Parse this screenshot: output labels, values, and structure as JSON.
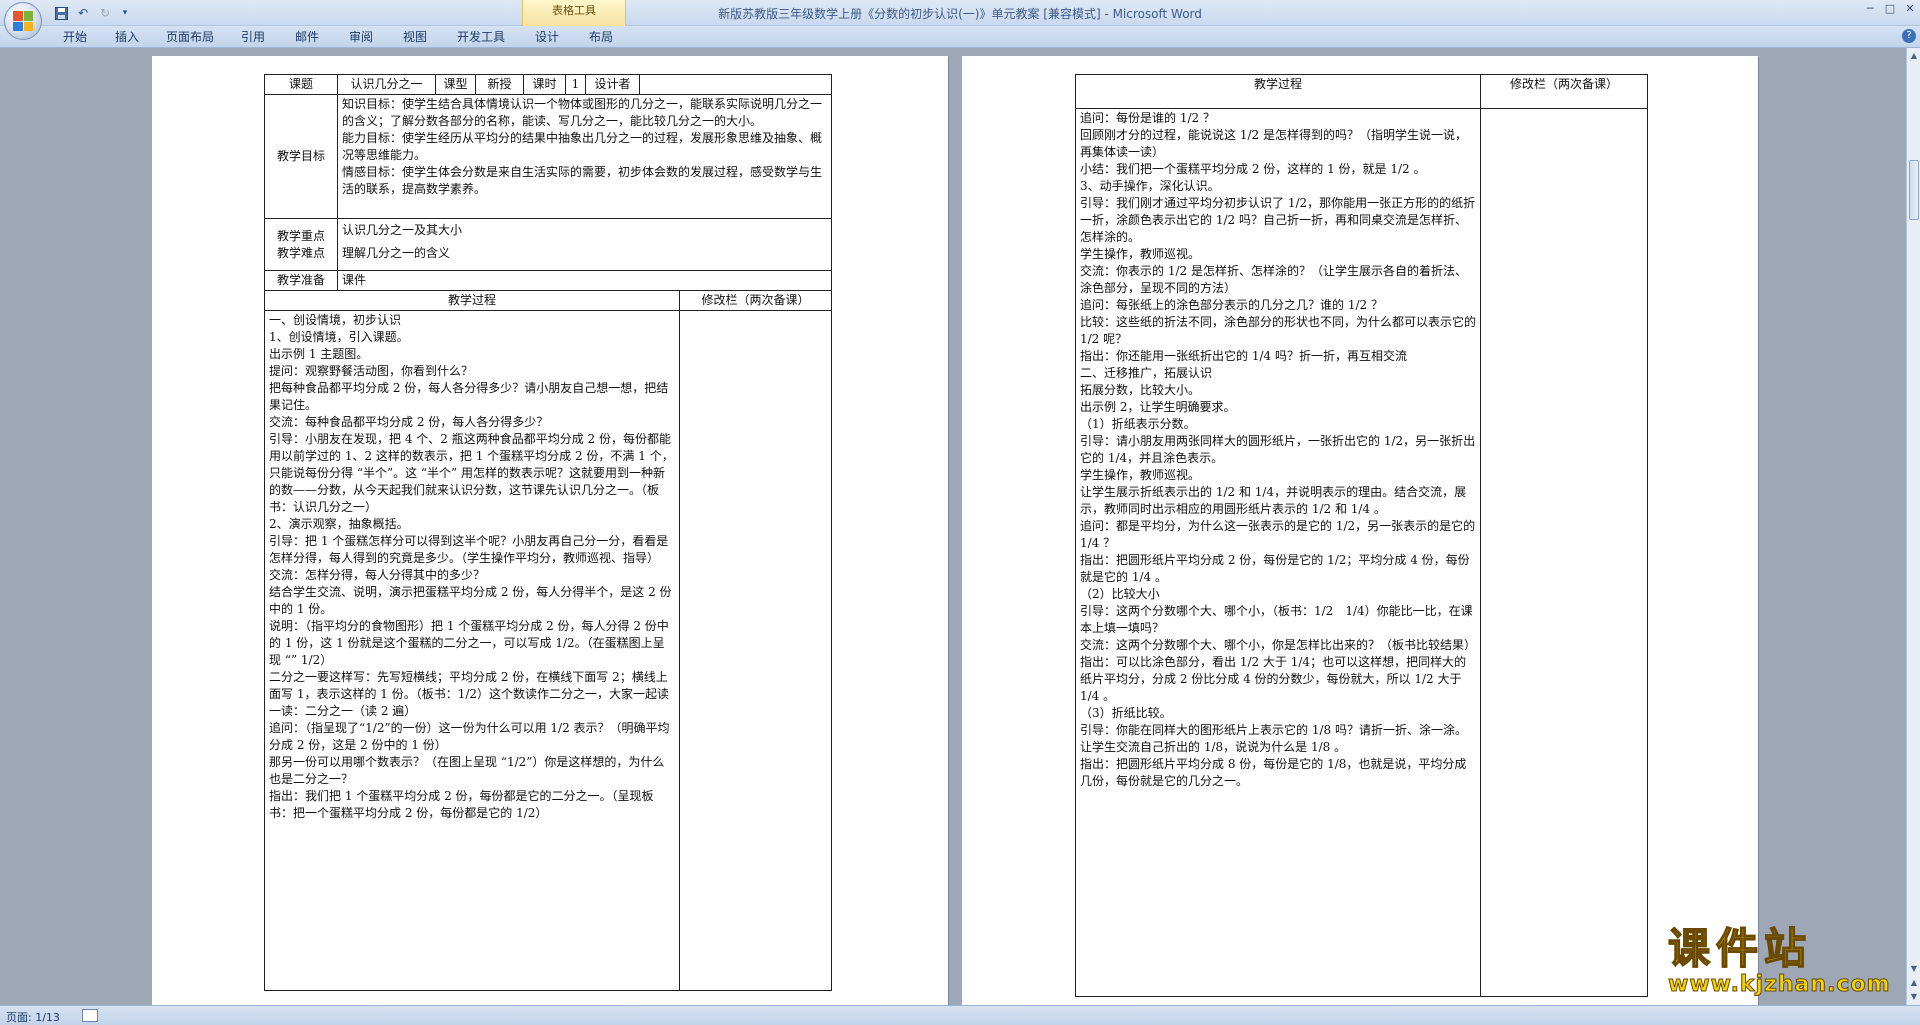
{
  "window": {
    "title": "新版苏教版三年级数学上册《分数的初步认识(一)》单元教案 [兼容模式] - Microsoft Word",
    "contextual_group": "表格工具",
    "controls": {
      "minimize": "─",
      "maximize": "□",
      "close": "✕"
    }
  },
  "quick_access": {
    "save": "save-icon",
    "undo": "↶",
    "redo": "↻",
    "customize": "▾"
  },
  "ribbon": {
    "tabs": [
      "开始",
      "插入",
      "页面布局",
      "引用",
      "邮件",
      "审阅",
      "视图",
      "开发工具",
      "设计",
      "布局"
    ],
    "help": "?"
  },
  "left_page": {
    "header": {
      "topic_label": "课题",
      "topic_value": "认识几分之一",
      "type_label": "课型",
      "type_value": "新授",
      "hours_label": "课时",
      "hours_value": "1",
      "designer_label": "设计者",
      "designer_value": ""
    },
    "goals_label": "教学目标",
    "goals": [
      "知识目标：使学生结合具体情境认识一个物体或图形的几分之一，能联系实际说明几分之一的含义；了解分数各部分的名称，能读、写几分之一，能比较几分之一的大小。",
      "能力目标：使学生经历从平均分的结果中抽象出几分之一的过程，发展形象思维及抽象、概况等思维能力。",
      "情感目标：使学生体会分数是来自生活实际的需要，初步体会数的发展过程，感受数学与生活的联系，提高数学素养。"
    ],
    "key_label": "教学重点",
    "key_value": "认识几分之一及其大小",
    "difficulty_label": "教学难点",
    "difficulty_value": "理解几分之一的含义",
    "prep_label": "教学准备",
    "prep_value": "课件",
    "process_label": "教学过程",
    "revision_label": "修改栏（两次备课）",
    "process_lines": [
      "一、创设情境，初步认识",
      "1、创设情境，引入课题。",
      "出示例 1 主题图。",
      "提问：观察野餐活动图，你看到什么？",
      "把每种食品都平均分成 2 份，每人各分得多少？请小朋友自己想一想，把结果记住。",
      "交流：每种食品都平均分成 2 份，每人各分得多少？",
      "引导：小朋友在发现，把 4 个、2 瓶这两种食品都平均分成 2 份，每份都能用以前学过的 1、2 这样的数表示，把 1 个蛋糕平均分成 2 份，不满 1 个，只能说每份分得 “半个”。这 “半个” 用怎样的数表示呢？这就要用到一种新的数——分数，从今天起我们就来认识分数，这节课先认识几分之一。（板书：认识几分之一）",
      "2、演示观察，抽象概括。",
      "引导：把 1 个蛋糕怎样分可以得到这半个呢？小朋友再自己分一分，看看是怎样分得，每人得到的究竟是多少。（学生操作平均分，教师巡视、指导）",
      "交流：怎样分得，每人分得其中的多少？",
      "结合学生交流、说明，演示把蛋糕平均分成 2 份，每人分得半个，是这 2 份中的 1 份。",
      "说明：（指平均分的食物图形）把 1 个蛋糕平均分成 2 份，每人分得 2 份中的 1 份，这 1 份就是这个蛋糕的二分之一，可以写成 1/2。（在蛋糕图上呈现 “” 1/2）",
      "二分之一要这样写：先写短横线；平均分成 2 份，在横线下面写 2；横线上面写 1，表示这样的 1 份。（板书：1/2）这个数读作二分之一，大家一起读一读：二分之一（读 2 遍）",
      "追问：（指呈现了“1/2”的一份）这一份为什么可以用 1/2 表示？（明确平均分成 2 份，这是 2 份中的 1 份）",
      "那另一份可以用哪个数表示？（在图上呈现 “1/2”）你是这样想的，为什么也是二分之一？",
      "指出：我们把 1 个蛋糕平均分成 2 份，每份都是它的二分之一。（呈现板书：把一个蛋糕平均分成 2 份，每份都是它的 1/2）"
    ]
  },
  "right_page": {
    "process_label": "教学过程",
    "revision_label": "修改栏（两次备课）",
    "process_lines": [
      "追问：每份是谁的 1/2 ？",
      "回顾刚才分的过程，能说说这 1/2 是怎样得到的吗？（指明学生说一说，再集体读一读）",
      "小结：我们把一个蛋糕平均分成 2 份，这样的 1 份，就是 1/2 。",
      "3、动手操作，深化认识。",
      "引导：我们刚才通过平均分初步认识了 1/2，那你能用一张正方形的的纸折一折，涂颜色表示出它的 1/2 吗？自己折一折，再和同桌交流是怎样折、怎样涂的。",
      "学生操作，教师巡视。",
      "交流：你表示的 1/2 是怎样折、怎样涂的？（让学生展示各自的着折法、涂色部分，呈现不同的方法）",
      "追问：每张纸上的涂色部分表示的几分之几？谁的 1/2 ？",
      "比较：这些纸的折法不同，涂色部分的形状也不同，为什么都可以表示它的 1/2 呢？",
      "指出：你还能用一张纸折出它的 1/4 吗？折一折，再互相交流",
      "二、迁移推广，拓展认识",
      "拓展分数，比较大小。",
      "出示例 2，让学生明确要求。",
      "（1）折纸表示分数。",
      "引导：请小朋友用两张同样大的圆形纸片，一张折出它的 1/2，另一张折出它的 1/4，并且涂色表示。",
      "学生操作，教师巡视。",
      "让学生展示折纸表示出的 1/2 和 1/4，并说明表示的理由。结合交流，展示，教师同时出示相应的用圆形纸片表示的 1/2 和 1/4 。",
      "追问：都是平均分，为什么这一张表示的是它的 1/2，另一张表示的是它的 1/4 ？",
      "指出：把圆形纸片平均分成 2 份，每份是它的 1/2；平均分成 4 份，每份就是它的 1/4 。",
      "（2）比较大小",
      "引导：这两个分数哪个大、哪个小，（板书：1/2　1/4）你能比一比，在课本上填一填吗？",
      "交流：这两个分数哪个大、哪个小，你是怎样比出来的？（板书比较结果）",
      "指出：可以比涂色部分，看出 1/2 大于 1/4；也可以这样想，把同样大的纸片平均分，分成 2 份比分成 4 份的分数少，每份就大，所以 1/2 大于 1/4 。",
      "（3）折纸比较。",
      "引导：你能在同样大的图形纸片上表示它的 1/8 吗？请折一折、涂一涂。",
      "让学生交流自己折出的 1/8，说说为什么是 1/8 。",
      "指出：把圆形纸片平均分成 8 份，每份是它的 1/8，也就是说，平均分成几份，每份就是它的几分之一。"
    ]
  },
  "status": {
    "page": "页面: 1/13"
  },
  "watermark": {
    "brand": "课件站",
    "url": "www.kjzhan.com"
  }
}
